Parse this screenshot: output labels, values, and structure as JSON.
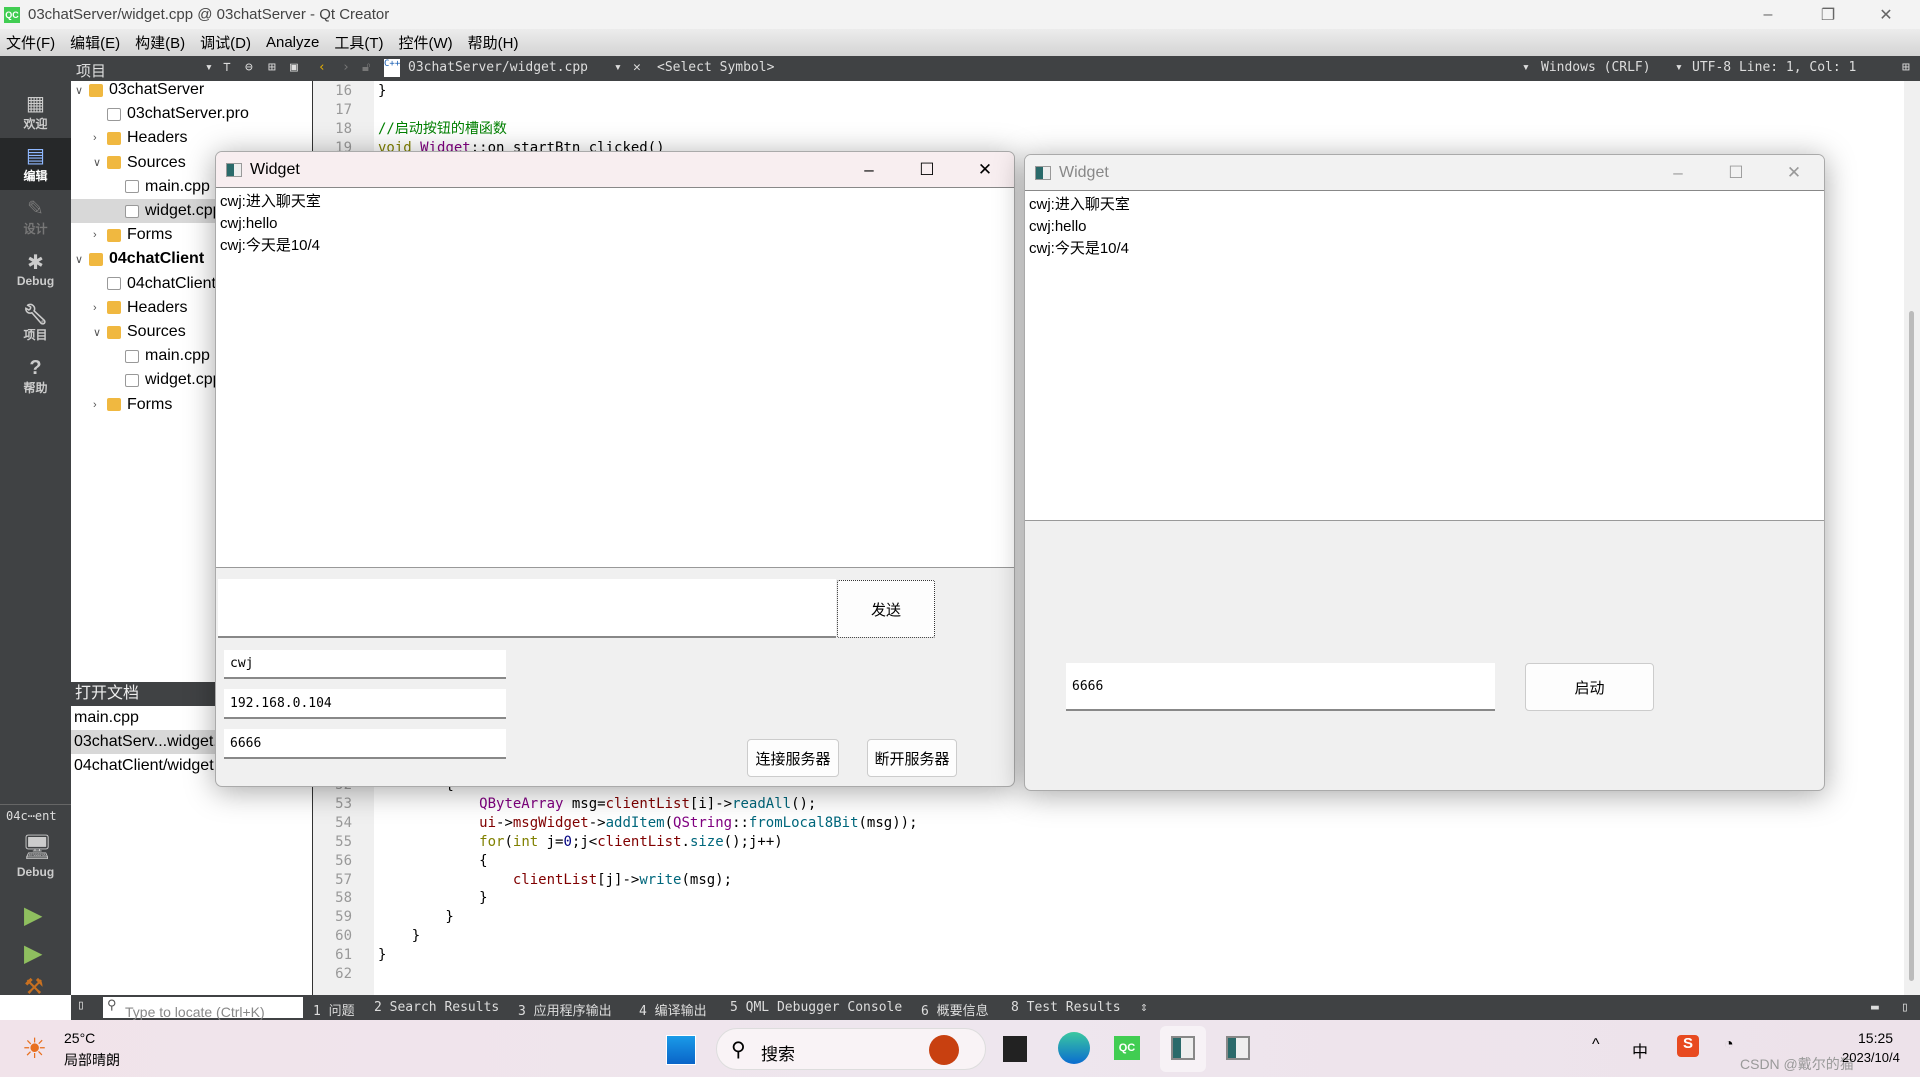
{
  "app": {
    "title": "03chatServer/widget.cpp @ 03chatServer - Qt Creator",
    "logo": "QC"
  },
  "menu": [
    "文件(F)",
    "编辑(E)",
    "构建(B)",
    "调试(D)",
    "Analyze",
    "工具(T)",
    "控件(W)",
    "帮助(H)"
  ],
  "toolbar": {
    "panel": "项目",
    "file": "03chatServer/widget.cpp",
    "symbol": "<Select Symbol>",
    "line_ending": "Windows (CRLF)",
    "encoding": "UTF-8 Line: 1, Col: 1"
  },
  "modes": [
    {
      "label": "欢迎",
      "icon": "grid-icon"
    },
    {
      "label": "编辑",
      "icon": "edit-icon"
    },
    {
      "label": "设计",
      "icon": "pencil-icon"
    },
    {
      "label": "Debug",
      "icon": "bug-icon"
    },
    {
      "label": "项目",
      "icon": "wrench-icon"
    },
    {
      "label": "帮助",
      "icon": "help-icon"
    }
  ],
  "kit": {
    "project": "04c⋯ent",
    "config": "Debug"
  },
  "tree": [
    {
      "label": "03chatServer",
      "level": 0,
      "exp": "v",
      "bold": false
    },
    {
      "label": "03chatServer.pro",
      "level": 1,
      "exp": ""
    },
    {
      "label": "Headers",
      "level": 1,
      "exp": ">"
    },
    {
      "label": "Sources",
      "level": 1,
      "exp": "v"
    },
    {
      "label": "main.cpp",
      "level": 2,
      "exp": ""
    },
    {
      "label": "widget.cpp",
      "level": 2,
      "exp": "",
      "sel": true
    },
    {
      "label": "Forms",
      "level": 1,
      "exp": ">"
    },
    {
      "label": "04chatClient",
      "level": 0,
      "exp": "v",
      "bold": true
    },
    {
      "label": "04chatClient.pro",
      "level": 1,
      "exp": ""
    },
    {
      "label": "Headers",
      "level": 1,
      "exp": ">"
    },
    {
      "label": "Sources",
      "level": 1,
      "exp": "v"
    },
    {
      "label": "main.cpp",
      "level": 2,
      "exp": ""
    },
    {
      "label": "widget.cpp",
      "level": 2,
      "exp": ""
    },
    {
      "label": "Forms",
      "level": 1,
      "exp": ">"
    }
  ],
  "open_docs": {
    "title": "打开文档",
    "items": [
      "main.cpp",
      "03chatServ...widget.cpp",
      "04chatClient/widget.cpp"
    ]
  },
  "code_top": [
    {
      "n": "16",
      "html": "}"
    },
    {
      "n": "17",
      "html": ""
    },
    {
      "n": "18",
      "html": "<span class='cm'>//启动按钮的槽函数</span>"
    },
    {
      "n": "19",
      "html": "<span class='kw'>void</span> <span class='ty'>Widget</span>::on_startBtn_clicked()"
    }
  ],
  "code_bottom": [
    {
      "n": "52",
      "html": "        {"
    },
    {
      "n": "53",
      "html": "            <span class='ty'>QByteArray</span> msg=<span class='var'>clientList</span>[i]-&gt;<span class='fn'>readAll</span>();"
    },
    {
      "n": "54",
      "html": "            <span class='var'>ui</span>-&gt;<span class='var'>msgWidget</span>-&gt;<span class='fn'>addItem</span>(<span class='ty'>QString</span>::<span class='fn'>fromLocal8Bit</span>(msg));"
    },
    {
      "n": "55",
      "html": "            <span class='kw'>for</span>(<span class='kw'>int</span> j=<span class='num'>0</span>;j&lt;<span class='var'>clientList</span>.<span class='fn'>size</span>();j++)"
    },
    {
      "n": "56",
      "html": "            {"
    },
    {
      "n": "57",
      "html": "                <span class='var'>clientList</span>[j]-&gt;<span class='fn'>write</span>(msg);"
    },
    {
      "n": "58",
      "html": "            }"
    },
    {
      "n": "59",
      "html": "        }"
    },
    {
      "n": "60",
      "html": "    }"
    },
    {
      "n": "61",
      "html": "}"
    },
    {
      "n": "62",
      "html": ""
    }
  ],
  "output_tabs": [
    "1 问题",
    "2 Search Results",
    "3 应用程序输出",
    "4 编译输出",
    "5 QML Debugger Console",
    "6 概要信息",
    "8 Test Results"
  ],
  "locate_placeholder": "Type to locate (Ctrl+K)",
  "client": {
    "title": "Widget",
    "messages": [
      "cwj:进入聊天室",
      "cwj:hello",
      "cwj:今天是10/4"
    ],
    "send_input": "",
    "send_label": "发送",
    "name": "cwj",
    "ip": "192.168.0.104",
    "port": "6666",
    "connect_label": "连接服务器",
    "disconnect_label": "断开服务器"
  },
  "server": {
    "title": "Widget",
    "messages": [
      "cwj:进入聊天室",
      "cwj:hello",
      "cwj:今天是10/4"
    ],
    "port": "6666",
    "start_label": "启动"
  },
  "taskbar": {
    "weather_temp": "25°C",
    "weather_desc": "局部晴朗",
    "search": "搜索",
    "time": "15:25",
    "date": "2023/10/4",
    "ime": "中",
    "watermark": "CSDN @戴尔的猫"
  }
}
